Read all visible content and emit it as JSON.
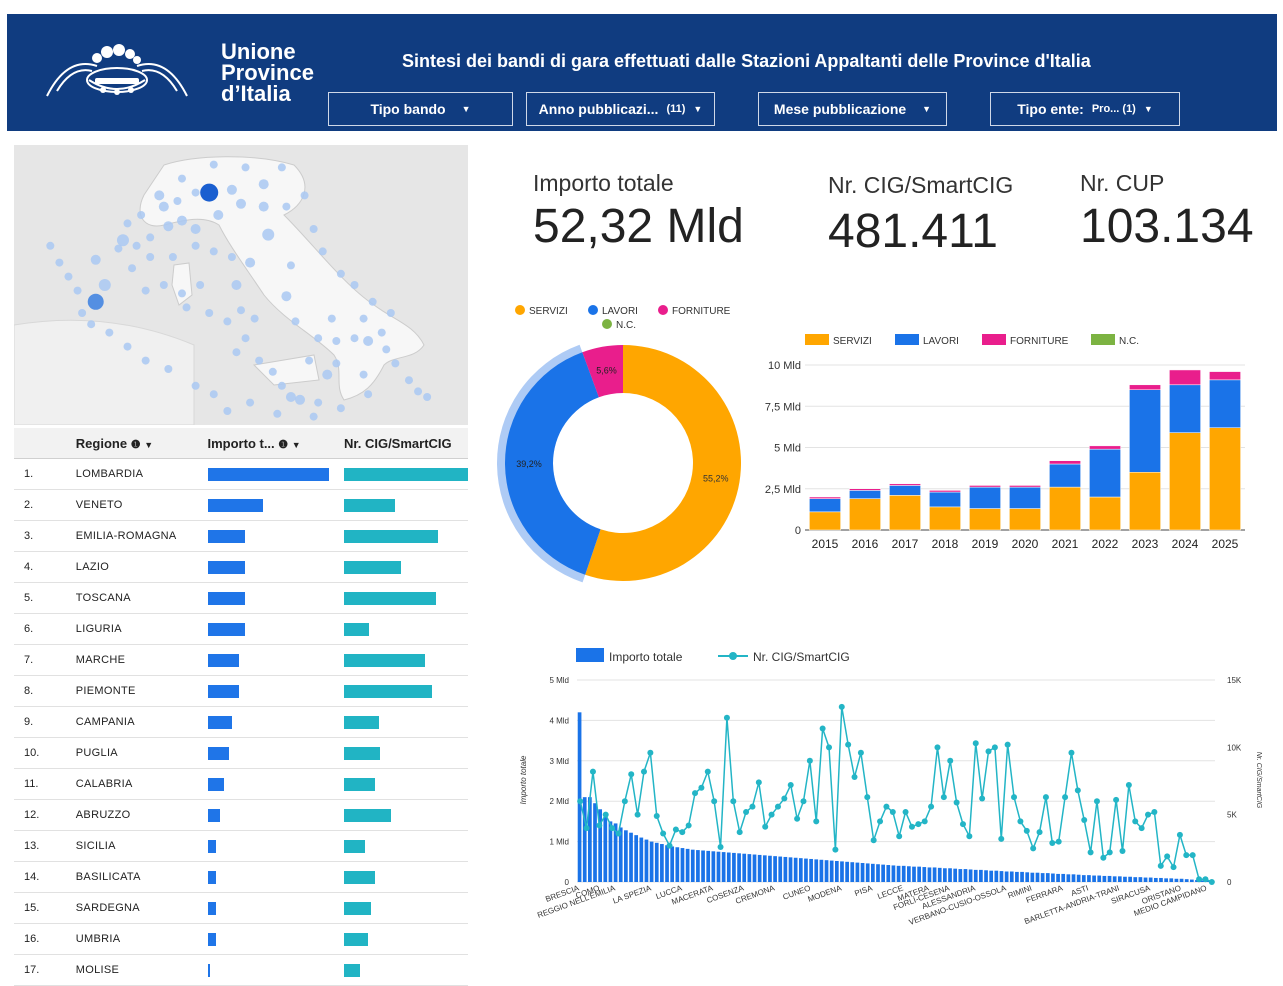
{
  "header": {
    "logo_lines": [
      "Unione",
      "Province",
      "d’Italia"
    ],
    "title": "Sintesi dei bandi di gara effettuati dalle Stazioni Appaltanti delle Province d'Italia",
    "filters": [
      {
        "label": "Tipo bando",
        "count": ""
      },
      {
        "label": "Anno pubblicazi...",
        "count": "(11)"
      },
      {
        "label": "Mese pubblicazione",
        "count": ""
      },
      {
        "label": "Tipo ente:",
        "count": "Pro... (1)"
      }
    ]
  },
  "kpis": {
    "importo_label": "Importo totale",
    "importo_value": "52,32 Mld",
    "cig_label": "Nr. CIG/SmartCIG",
    "cig_value": "481.411",
    "cup_label": "Nr. CUP",
    "cup_value": "103.134"
  },
  "table": {
    "headers": [
      "Regione",
      "Importo t...",
      "Nr. CIG/SmartCIG"
    ],
    "rows": [
      {
        "rank": "1.",
        "region": "LOMBARDIA",
        "importo_frac": 1.0,
        "cig_frac": 1.0
      },
      {
        "rank": "2.",
        "region": "VENETO",
        "importo_frac": 0.46,
        "cig_frac": 0.41
      },
      {
        "rank": "3.",
        "region": "EMILIA-ROMAGNA",
        "importo_frac": 0.31,
        "cig_frac": 0.76
      },
      {
        "rank": "4.",
        "region": "LAZIO",
        "importo_frac": 0.31,
        "cig_frac": 0.46
      },
      {
        "rank": "5.",
        "region": "TOSCANA",
        "importo_frac": 0.31,
        "cig_frac": 0.74
      },
      {
        "rank": "6.",
        "region": "LIGURIA",
        "importo_frac": 0.31,
        "cig_frac": 0.2
      },
      {
        "rank": "7.",
        "region": "MARCHE",
        "importo_frac": 0.26,
        "cig_frac": 0.65
      },
      {
        "rank": "8.",
        "region": "PIEMONTE",
        "importo_frac": 0.26,
        "cig_frac": 0.71
      },
      {
        "rank": "9.",
        "region": "CAMPANIA",
        "importo_frac": 0.2,
        "cig_frac": 0.28
      },
      {
        "rank": "10.",
        "region": "PUGLIA",
        "importo_frac": 0.18,
        "cig_frac": 0.29
      },
      {
        "rank": "11.",
        "region": "CALABRIA",
        "importo_frac": 0.14,
        "cig_frac": 0.25
      },
      {
        "rank": "12.",
        "region": "ABRUZZO",
        "importo_frac": 0.1,
        "cig_frac": 0.38
      },
      {
        "rank": "13.",
        "region": "SICILIA",
        "importo_frac": 0.07,
        "cig_frac": 0.17
      },
      {
        "rank": "14.",
        "region": "BASILICATA",
        "importo_frac": 0.07,
        "cig_frac": 0.25
      },
      {
        "rank": "15.",
        "region": "SARDEGNA",
        "importo_frac": 0.07,
        "cig_frac": 0.22
      },
      {
        "rank": "16.",
        "region": "UMBRIA",
        "importo_frac": 0.07,
        "cig_frac": 0.19
      },
      {
        "rank": "17.",
        "region": "MOLISE",
        "importo_frac": 0.02,
        "cig_frac": 0.13
      }
    ]
  },
  "map_points": [
    [
      0.56,
      0.32,
      6
    ],
    [
      0.55,
      0.22,
      5
    ],
    [
      0.48,
      0.16,
      5
    ],
    [
      0.5,
      0.21,
      5
    ],
    [
      0.45,
      0.25,
      5
    ],
    [
      0.4,
      0.3,
      5
    ],
    [
      0.37,
      0.27,
      5
    ],
    [
      0.34,
      0.29,
      5
    ],
    [
      0.33,
      0.22,
      5
    ],
    [
      0.32,
      0.18,
      5
    ],
    [
      0.28,
      0.25,
      4
    ],
    [
      0.25,
      0.28,
      4
    ],
    [
      0.24,
      0.34,
      6
    ],
    [
      0.3,
      0.33,
      4
    ],
    [
      0.27,
      0.36,
      4
    ],
    [
      0.23,
      0.37,
      4
    ],
    [
      0.18,
      0.41,
      5
    ],
    [
      0.2,
      0.5,
      6
    ],
    [
      0.18,
      0.56,
      8
    ],
    [
      0.26,
      0.44,
      4
    ],
    [
      0.3,
      0.4,
      4
    ],
    [
      0.35,
      0.4,
      4
    ],
    [
      0.4,
      0.36,
      4
    ],
    [
      0.44,
      0.38,
      4
    ],
    [
      0.48,
      0.4,
      4
    ],
    [
      0.52,
      0.42,
      5
    ],
    [
      0.49,
      0.5,
      5
    ],
    [
      0.41,
      0.5,
      4
    ],
    [
      0.37,
      0.53,
      4
    ],
    [
      0.33,
      0.5,
      4
    ],
    [
      0.29,
      0.52,
      4
    ],
    [
      0.38,
      0.58,
      4
    ],
    [
      0.43,
      0.6,
      4
    ],
    [
      0.47,
      0.63,
      4
    ],
    [
      0.5,
      0.59,
      4
    ],
    [
      0.53,
      0.62,
      4
    ],
    [
      0.51,
      0.69,
      4
    ],
    [
      0.49,
      0.74,
      4
    ],
    [
      0.54,
      0.77,
      4
    ],
    [
      0.57,
      0.81,
      4
    ],
    [
      0.59,
      0.86,
      4
    ],
    [
      0.61,
      0.9,
      5
    ],
    [
      0.63,
      0.91,
      5
    ],
    [
      0.67,
      0.92,
      4
    ],
    [
      0.69,
      0.82,
      5
    ],
    [
      0.71,
      0.78,
      4
    ],
    [
      0.65,
      0.77,
      4
    ],
    [
      0.67,
      0.69,
      4
    ],
    [
      0.71,
      0.7,
      4
    ],
    [
      0.75,
      0.69,
      4
    ],
    [
      0.78,
      0.7,
      5
    ],
    [
      0.77,
      0.62,
      4
    ],
    [
      0.7,
      0.62,
      4
    ],
    [
      0.62,
      0.63,
      4
    ],
    [
      0.6,
      0.54,
      5
    ],
    [
      0.61,
      0.43,
      4
    ],
    [
      0.55,
      0.14,
      5
    ],
    [
      0.59,
      0.08,
      4
    ],
    [
      0.51,
      0.08,
      4
    ],
    [
      0.44,
      0.07,
      4
    ],
    [
      0.37,
      0.12,
      4
    ],
    [
      0.4,
      0.17,
      4
    ],
    [
      0.36,
      0.2,
      4
    ],
    [
      0.6,
      0.22,
      4
    ],
    [
      0.64,
      0.18,
      4
    ],
    [
      0.66,
      0.3,
      4
    ],
    [
      0.68,
      0.38,
      4
    ],
    [
      0.72,
      0.46,
      4
    ],
    [
      0.75,
      0.5,
      4
    ],
    [
      0.79,
      0.56,
      4
    ],
    [
      0.83,
      0.6,
      4
    ],
    [
      0.81,
      0.67,
      4
    ],
    [
      0.82,
      0.73,
      4
    ],
    [
      0.84,
      0.78,
      4
    ],
    [
      0.87,
      0.84,
      4
    ],
    [
      0.89,
      0.88,
      4
    ],
    [
      0.91,
      0.9,
      4
    ],
    [
      0.77,
      0.82,
      4
    ],
    [
      0.78,
      0.89,
      4
    ],
    [
      0.72,
      0.94,
      4
    ],
    [
      0.66,
      0.97,
      4
    ],
    [
      0.58,
      0.96,
      4
    ],
    [
      0.52,
      0.92,
      4
    ],
    [
      0.47,
      0.95,
      4
    ],
    [
      0.44,
      0.89,
      4
    ],
    [
      0.4,
      0.86,
      4
    ],
    [
      0.34,
      0.8,
      4
    ],
    [
      0.29,
      0.77,
      4
    ],
    [
      0.25,
      0.72,
      4
    ],
    [
      0.21,
      0.67,
      4
    ],
    [
      0.17,
      0.64,
      4
    ],
    [
      0.15,
      0.6,
      4
    ],
    [
      0.14,
      0.52,
      4
    ],
    [
      0.12,
      0.47,
      4
    ],
    [
      0.1,
      0.42,
      4
    ],
    [
      0.08,
      0.36,
      4
    ]
  ],
  "chart_data": [
    {
      "type": "pie",
      "title": "",
      "legend": [
        "SERVIZI",
        "LAVORI",
        "FORNITURE",
        "N.C."
      ],
      "legend_position": "top",
      "slices": [
        {
          "label": "SERVIZI",
          "value": 55.2,
          "value_label": "55,2%",
          "color": "#ffa600"
        },
        {
          "label": "LAVORI",
          "value": 39.2,
          "value_label": "39,2%",
          "color": "#1a73e8"
        },
        {
          "label": "FORNITURE",
          "value": 5.6,
          "value_label": "5,6%",
          "color": "#e91e8c"
        },
        {
          "label": "N.C.",
          "value": 0.0,
          "value_label": "",
          "color": "#7cb342"
        }
      ]
    },
    {
      "type": "bar",
      "stacked": true,
      "title": "",
      "categories": [
        "2015",
        "2016",
        "2017",
        "2018",
        "2019",
        "2020",
        "2021",
        "2022",
        "2023",
        "2024",
        "2025"
      ],
      "series": [
        {
          "name": "SERVIZI",
          "color": "#ffa600",
          "values": [
            1.1,
            1.9,
            2.1,
            1.4,
            1.3,
            1.3,
            2.6,
            2.0,
            3.5,
            5.9,
            6.2
          ]
        },
        {
          "name": "LAVORI",
          "color": "#1a73e8",
          "values": [
            0.8,
            0.5,
            0.6,
            0.9,
            1.3,
            1.3,
            1.4,
            2.9,
            5.0,
            2.9,
            2.9
          ]
        },
        {
          "name": "FORNITURE",
          "color": "#e91e8c",
          "values": [
            0.1,
            0.1,
            0.1,
            0.1,
            0.1,
            0.1,
            0.2,
            0.2,
            0.3,
            0.9,
            0.5
          ]
        },
        {
          "name": "N.C.",
          "color": "#7cb342",
          "values": [
            0,
            0,
            0,
            0,
            0,
            0,
            0,
            0,
            0,
            0,
            0
          ]
        }
      ],
      "ylim": [
        0,
        10
      ],
      "yticks": [
        0,
        2.5,
        5,
        7.5,
        10
      ],
      "ytick_labels": [
        "0",
        "2,5 Mld",
        "5 Mld",
        "7,5 Mld",
        "10 Mld"
      ],
      "legend_position": "top"
    },
    {
      "type": "bar",
      "combo": "bar + line (dual axis)",
      "title": "",
      "ylabel": "Importo totale",
      "y2label": "Nr. CIG/SmartCIG",
      "ylim": [
        0,
        5
      ],
      "ytick_labels": [
        "0",
        "1 Mld",
        "2 Mld",
        "3 Mld",
        "4 Mld",
        "5 Mld"
      ],
      "y2lim": [
        0,
        15000
      ],
      "y2tick_labels": [
        "0",
        "5K",
        "10K",
        "15K"
      ],
      "legend": [
        "Importo totale",
        "Nr. CIG/SmartCIG"
      ],
      "legend_position": "top",
      "grid": true,
      "x_labels": [
        {
          "i": 0,
          "label": "BRESCIA"
        },
        {
          "i": 4,
          "label": "COMO"
        },
        {
          "i": 7,
          "label": "REGGIO NELL'EMILIA"
        },
        {
          "i": 14,
          "label": "LA SPEZIA"
        },
        {
          "i": 20,
          "label": "LUCCA"
        },
        {
          "i": 26,
          "label": "MACERATA"
        },
        {
          "i": 32,
          "label": "COSENZA"
        },
        {
          "i": 38,
          "label": "CREMONA"
        },
        {
          "i": 45,
          "label": "CUNEO"
        },
        {
          "i": 51,
          "label": "MODENA"
        },
        {
          "i": 57,
          "label": "PISA"
        },
        {
          "i": 63,
          "label": "LECCE"
        },
        {
          "i": 68,
          "label": "MATERA"
        },
        {
          "i": 72,
          "label": "FORLÌ-CESENA"
        },
        {
          "i": 77,
          "label": "ALESSANDRIA"
        },
        {
          "i": 83,
          "label": "VERBANO-CUSIO-OSSOLA"
        },
        {
          "i": 88,
          "label": "RIMINI"
        },
        {
          "i": 94,
          "label": "FERRARA"
        },
        {
          "i": 99,
          "label": "ASTI"
        },
        {
          "i": 105,
          "label": "BARLETTA-ANDRIA-TRANI"
        },
        {
          "i": 111,
          "label": "SIRACUSA"
        },
        {
          "i": 117,
          "label": "ORISTANO"
        },
        {
          "i": 122,
          "label": "MEDIO CAMPIDANO"
        }
      ],
      "bar_values": [
        4.2,
        2.1,
        2.1,
        1.95,
        1.8,
        1.6,
        1.5,
        1.45,
        1.35,
        1.28,
        1.22,
        1.16,
        1.1,
        1.05,
        1.0,
        0.97,
        0.94,
        0.91,
        0.88,
        0.86,
        0.84,
        0.82,
        0.8,
        0.79,
        0.78,
        0.77,
        0.76,
        0.75,
        0.74,
        0.73,
        0.72,
        0.71,
        0.7,
        0.69,
        0.68,
        0.67,
        0.66,
        0.65,
        0.64,
        0.63,
        0.62,
        0.61,
        0.6,
        0.59,
        0.58,
        0.57,
        0.56,
        0.55,
        0.54,
        0.53,
        0.52,
        0.51,
        0.5,
        0.49,
        0.48,
        0.47,
        0.46,
        0.45,
        0.44,
        0.43,
        0.42,
        0.41,
        0.4,
        0.4,
        0.39,
        0.38,
        0.38,
        0.37,
        0.36,
        0.36,
        0.35,
        0.34,
        0.34,
        0.33,
        0.32,
        0.32,
        0.31,
        0.3,
        0.3,
        0.29,
        0.28,
        0.28,
        0.27,
        0.26,
        0.26,
        0.25,
        0.25,
        0.24,
        0.23,
        0.23,
        0.22,
        0.22,
        0.21,
        0.2,
        0.2,
        0.19,
        0.19,
        0.18,
        0.17,
        0.17,
        0.16,
        0.16,
        0.15,
        0.15,
        0.14,
        0.14,
        0.13,
        0.13,
        0.12,
        0.12,
        0.11,
        0.11,
        0.1,
        0.1,
        0.09,
        0.09,
        0.08,
        0.08,
        0.07,
        0.06,
        0.05,
        0.04,
        0.03,
        0.02
      ],
      "line_values": [
        6000,
        4000,
        8200,
        4200,
        5000,
        4000,
        3600,
        6000,
        8000,
        5000,
        8200,
        9600,
        4900,
        3600,
        2700,
        3900,
        3700,
        4200,
        6600,
        7000,
        8200,
        6000,
        2600,
        12200,
        6000,
        3700,
        5200,
        5600,
        7400,
        4100,
        5000,
        5600,
        6200,
        7200,
        4700,
        6000,
        9000,
        4500,
        11400,
        10000,
        2400,
        13000,
        10200,
        7800,
        9600,
        6300,
        3100,
        4500,
        5600,
        5200,
        3400,
        5200,
        4100,
        4300,
        4500,
        5600,
        10000,
        6300,
        9000,
        5900,
        4300,
        3400,
        10300,
        6200,
        9700,
        10000,
        3200,
        10200,
        6300,
        4500,
        3800,
        2500,
        3700,
        6300,
        2900,
        3000,
        6300,
        9600,
        6800,
        4600,
        2200,
        6000,
        1800,
        2200,
        6100,
        2300,
        7200,
        4500,
        4000,
        5000,
        5200,
        1200,
        1900,
        1100,
        3500,
        2000,
        2000,
        200,
        200,
        0
      ]
    }
  ]
}
